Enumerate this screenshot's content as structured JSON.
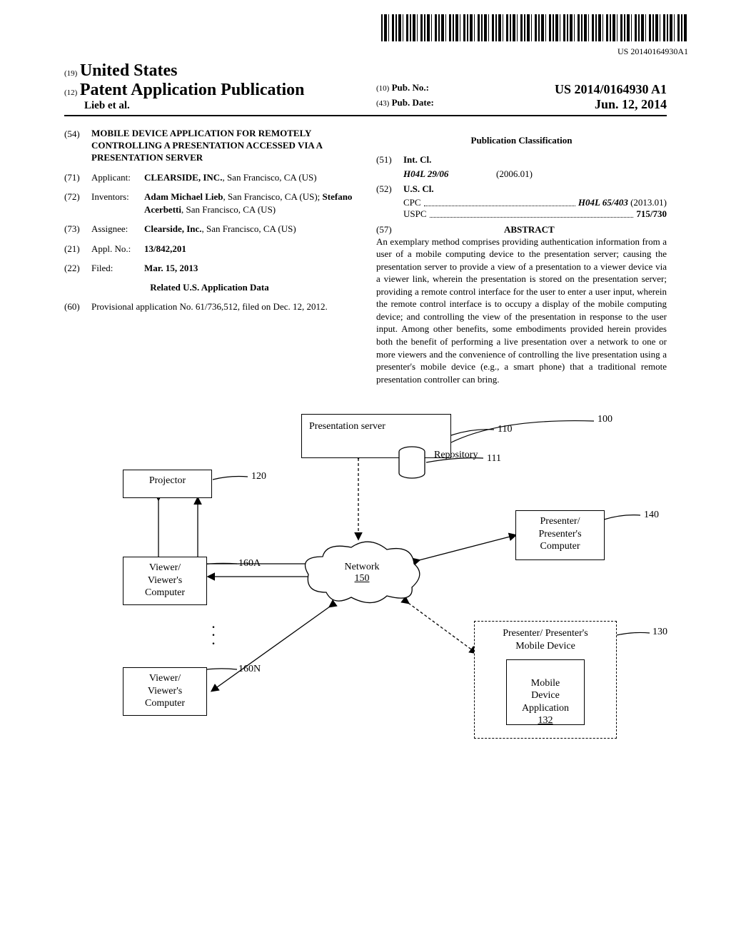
{
  "barcode_text": "US 20140164930A1",
  "header": {
    "code19": "(19)",
    "country": "United States",
    "code12": "(12)",
    "pub_title": "Patent Application Publication",
    "author": "Lieb et al.",
    "code10": "(10)",
    "pubno_label": "Pub. No.:",
    "pubno": "US 2014/0164930 A1",
    "code43": "(43)",
    "pubdate_label": "Pub. Date:",
    "pubdate": "Jun. 12, 2014"
  },
  "f54": {
    "num": "(54)",
    "title": "MOBILE DEVICE APPLICATION FOR REMOTELY CONTROLLING A PRESENTATION ACCESSED VIA A PRESENTATION SERVER"
  },
  "f71": {
    "num": "(71)",
    "lbl": "Applicant:",
    "val_b": "CLEARSIDE, INC.",
    "val_rest": ", San Francisco, CA (US)"
  },
  "f72": {
    "num": "(72)",
    "lbl": "Inventors:",
    "val": "Adam Michael Lieb",
    "val2": ", San Francisco, CA (US); ",
    "val3": "Stefano Acerbetti",
    "val4": ", San Francisco, CA (US)"
  },
  "f73": {
    "num": "(73)",
    "lbl": "Assignee:",
    "val_b": "Clearside, Inc.",
    "val_rest": ", San Francisco, CA (US)"
  },
  "f21": {
    "num": "(21)",
    "lbl": "Appl. No.:",
    "val": "13/842,201"
  },
  "f22": {
    "num": "(22)",
    "lbl": "Filed:",
    "val": "Mar. 15, 2013"
  },
  "related_title": "Related U.S. Application Data",
  "f60": {
    "num": "(60)",
    "val": "Provisional application No. 61/736,512, filed on Dec. 12, 2012."
  },
  "pubclass_title": "Publication Classification",
  "f51": {
    "num": "(51)",
    "lbl": "Int. Cl.",
    "row1_a": "H04L 29/06",
    "row1_b": "(2006.01)"
  },
  "f52": {
    "num": "(52)",
    "lbl": "U.S. Cl.",
    "cpc_lbl": "CPC",
    "cpc_val": "H04L 65/403",
    "cpc_date": "(2013.01)",
    "uspc_lbl": "USPC",
    "uspc_val": "715/730"
  },
  "f57": {
    "num": "(57)",
    "lbl": "ABSTRACT"
  },
  "abstract": "An exemplary method comprises providing authentication information from a user of a mobile computing device to the presentation server; causing the presentation server to provide a view of a presentation to a viewer device via a viewer link, wherein the presentation is stored on the presentation server; providing a remote control interface for the user to enter a user input, wherein the remote control interface is to occupy a display of the mobile computing device; and controlling the view of the presentation in response to the user input. Among other benefits, some embodiments provided herein provides both the benefit of performing a live presentation over a network to one or more viewers and the convenience of controlling the live presentation using a presenter's mobile device (e.g., a smart phone) that a traditional remote presentation controller can bring.",
  "diagram": {
    "n100": "100",
    "n110": "110",
    "n111": "111",
    "n120": "120",
    "n130": "130",
    "n132": "132",
    "n140": "140",
    "n150": "150",
    "n160a": "160A",
    "n160n": "160N",
    "server": "Presentation server",
    "repo": "Repository",
    "projector": "Projector",
    "viewer": "Viewer/\nViewer's\nComputer",
    "network": "Network",
    "presenter_comp": "Presenter/\nPresenter's\nComputer",
    "presenter_mobile": "Presenter/ Presenter's\nMobile Device",
    "mobile_app": "Mobile\nDevice\nApplication"
  }
}
